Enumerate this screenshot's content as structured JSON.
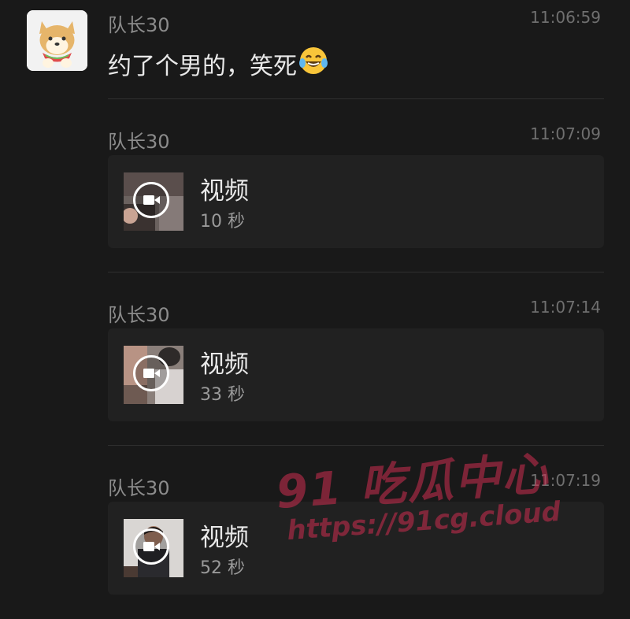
{
  "messages": [
    {
      "sender": "队长30",
      "time": "11:06:59",
      "text": "约了个男的，笑死",
      "emoji": "😂"
    },
    {
      "sender": "队长30",
      "time": "11:07:09",
      "card_title": "视频",
      "duration": "10 秒"
    },
    {
      "sender": "队长30",
      "time": "11:07:14",
      "card_title": "视频",
      "duration": "33 秒"
    },
    {
      "sender": "队长30",
      "time": "11:07:19",
      "card_title": "视频",
      "duration": "52 秒"
    }
  ],
  "watermark": {
    "line1": "91 吃瓜中心",
    "line2": "https://91cg.cloud"
  },
  "icons": {
    "avatar": "shiba-dog-avatar",
    "video": "video-camera-icon"
  },
  "colors": {
    "background": "#191919",
    "card": "#212121",
    "watermark": "#cd2d50"
  }
}
